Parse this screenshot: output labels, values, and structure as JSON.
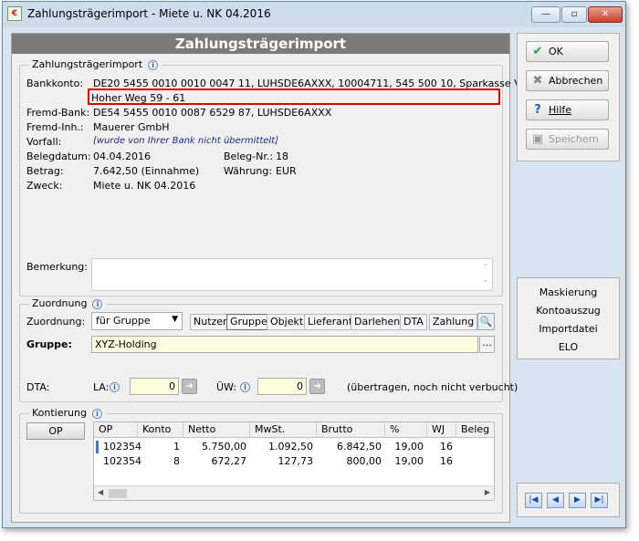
{
  "window": {
    "title": "Zahlungsträgerimport - Miete u. NK 04.2016"
  },
  "panel": {
    "title": "Zahlungsträgerimport"
  },
  "import_section": {
    "title": "Zahlungsträgerimport",
    "bankkonto_label": "Bankkonto:",
    "bankkonto_value": "DE20 5455 0010 0010 0047 11,  LUHSDE6AXXX,  10004711,  545 500 10,  Sparkasse Vord",
    "bankkonto_line2": "Hoher Weg 59 - 61",
    "fremd_bank_label": "Fremd-Bank:",
    "fremd_bank_value": "DE54 5455 0010 0087 6529 87,  LUHSDE6AXXX",
    "fremd_inh_label": "Fremd-Inh.:",
    "fremd_inh_value": "Mauerer GmbH",
    "vorfall_label": "Vorfall:",
    "vorfall_value": "[wurde von Ihrer Bank nicht übermittelt]",
    "belegdatum_label": "Belegdatum:",
    "belegdatum_value": "04.04.2016",
    "beleg_nr_label": "Beleg-Nr.:",
    "beleg_nr_value": "18",
    "betrag_label": "Betrag:",
    "betrag_value": "7.642,50 (Einnahme)",
    "waehrung_label": "Währung:",
    "waehrung_value": "EUR",
    "zweck_label": "Zweck:",
    "zweck_value": "Miete u. NK 04.2016",
    "bemerkung_label": "Bemerkung:",
    "bemerkung_value": ""
  },
  "zuordnung": {
    "title": "Zuordnung",
    "label": "Zuordnung:",
    "select_value": "für Gruppe",
    "tabs": [
      "Nutzer",
      "Gruppe",
      "Objekt",
      "Lieferant",
      "Darlehen",
      "DTA",
      "Zahlung"
    ],
    "active_tab": "Gruppe",
    "gruppe_label": "Gruppe:",
    "gruppe_value": "XYZ-Holding",
    "ellipsis": "...",
    "dta_label": "DTA:",
    "la_label": "LA:",
    "la_value": "0",
    "uew_label": "ÜW:",
    "uew_value": "0",
    "status_text": "(übertragen, noch nicht verbucht)"
  },
  "kontierung": {
    "title": "Kontierung",
    "op_button": "OP",
    "columns": [
      "OP",
      "Konto",
      "Netto",
      "MwSt.",
      "Brutto",
      "%",
      "WJ",
      "Beleg"
    ],
    "rows": [
      [
        "102354",
        "1",
        "5.750,00",
        "1.092,50",
        "6.842,50",
        "19,00",
        "16",
        ""
      ],
      [
        "102354",
        "8",
        "672,27",
        "127,73",
        "800,00",
        "19,00",
        "16",
        ""
      ]
    ]
  },
  "actions": {
    "ok": "OK",
    "abbrechen": "Abbrechen",
    "hilfe": "Hilfe",
    "speichern": "Speichern"
  },
  "links": [
    "Maskierung",
    "Kontoauszug",
    "Importdatei",
    "ELO"
  ],
  "icons": [
    "check-icon",
    "cross-icon",
    "help-icon",
    "save-icon",
    "info-icon",
    "search-icon",
    "arrow-right-icon",
    "first-icon",
    "prev-icon",
    "next-icon",
    "last-icon"
  ]
}
